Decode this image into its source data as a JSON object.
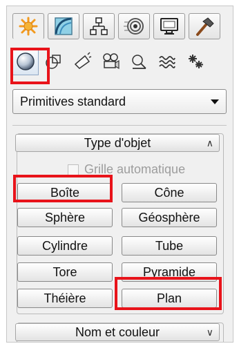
{
  "tabs": [
    {
      "icon": "create-sunburst-icon"
    },
    {
      "icon": "modify-curve-icon"
    },
    {
      "icon": "hierarchy-icon"
    },
    {
      "icon": "motion-rings-icon"
    },
    {
      "icon": "display-monitor-icon"
    },
    {
      "icon": "utilities-hammer-icon"
    }
  ],
  "categories": [
    {
      "icon": "geometry-sphere-icon",
      "selected": true
    },
    {
      "icon": "shapes-icon"
    },
    {
      "icon": "lights-icon"
    },
    {
      "icon": "cameras-icon"
    },
    {
      "icon": "helpers-icon"
    },
    {
      "icon": "space-warps-icon"
    },
    {
      "icon": "systems-icon"
    }
  ],
  "dropdown": {
    "value": "Primitives standard"
  },
  "object_type": {
    "title": "Type d'objet",
    "autogrid_label": "Grille automatique",
    "buttons": [
      "Boîte",
      "Cône",
      "Sphère",
      "Géosphère",
      "Cylindre",
      "Tube",
      "Tore",
      "Pyramide",
      "Théière",
      "Plan"
    ]
  },
  "name_color": {
    "title": "Nom et couleur"
  },
  "colors": {
    "highlight": "#e8131a",
    "panel": "#f0f0f0"
  }
}
